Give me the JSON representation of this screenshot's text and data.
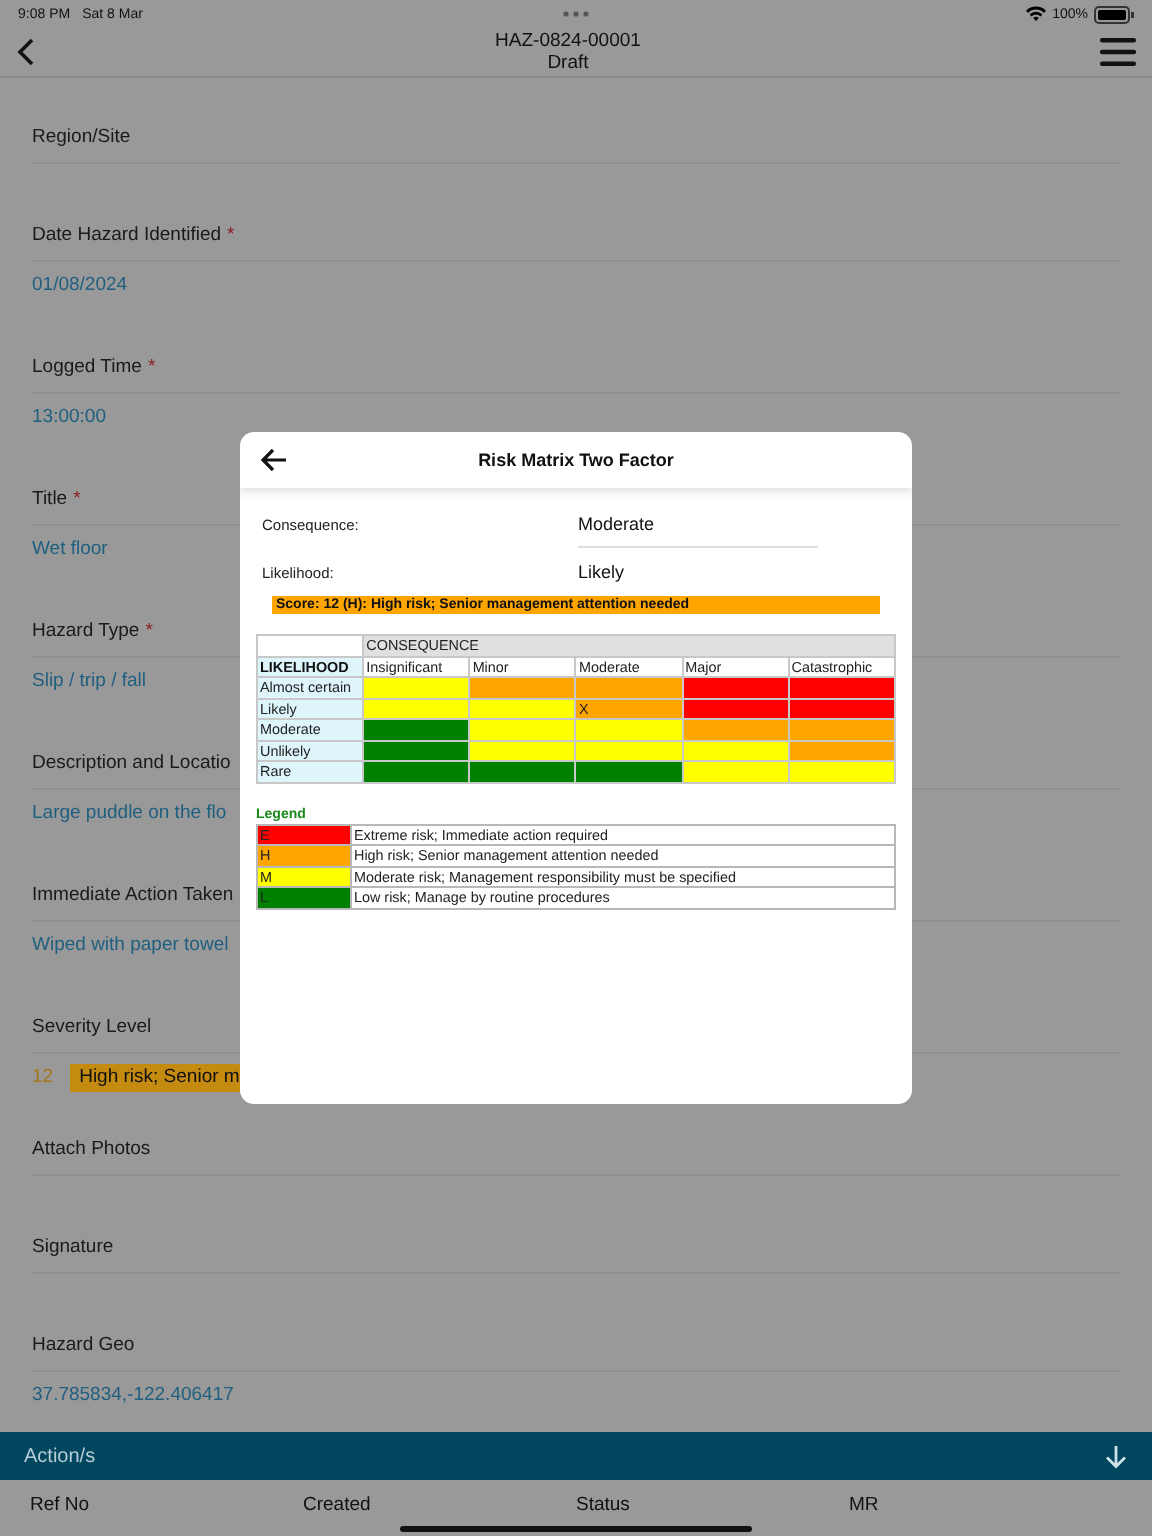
{
  "status_bar": {
    "time": "9:08 PM",
    "date": "Sat 8 Mar",
    "battery": "100%"
  },
  "nav": {
    "title": "HAZ-0824-00001",
    "subtitle": "Draft"
  },
  "fields": [
    {
      "label": "Region/Site"
    },
    {
      "label": "Date Hazard Identified",
      "required_mark": "*",
      "value": "01/08/2024"
    },
    {
      "label": "Logged Time",
      "required_mark": "*",
      "value": "13:00:00"
    },
    {
      "label": "Title",
      "required_mark": "*",
      "value": "Wet floor"
    },
    {
      "label": "Hazard Type",
      "required_mark": "*",
      "value": "Slip / trip / fall"
    },
    {
      "label": "Description and Locatio",
      "value": "Large puddle on the flo"
    },
    {
      "label": "Immediate Action Taken",
      "value": "Wiped with paper towel"
    },
    {
      "label": "Severity Level",
      "kind": "severity",
      "score": "12",
      "badge": "High risk; Senior m",
      "color": "#c58a10"
    },
    {
      "label": "Attach Photos"
    },
    {
      "label": "Signature"
    },
    {
      "label": "Hazard Geo",
      "value": "37.785834,-122.406417"
    }
  ],
  "actions": {
    "title": "Action/s",
    "columns": [
      "Ref No",
      "Created",
      "Status",
      "MR"
    ]
  },
  "modal": {
    "title": "Risk Matrix Two Factor",
    "rows": [
      {
        "label": "Consequence:",
        "value": "Moderate"
      },
      {
        "label": "Likelihood:",
        "value": "Likely"
      }
    ],
    "score": {
      "text": "Score: 12 (H): High risk; Senior management attention needed",
      "color": "#ffa500"
    },
    "matrix": {
      "group_header": "CONSEQUENCE",
      "corner": "LIKELIHOOD",
      "columns": [
        "Insignificant",
        "Minor",
        "Moderate",
        "Major",
        "Catastrophic"
      ],
      "rows": [
        {
          "label": "Almost certain",
          "cells": [
            {
              "color": "#ffff00"
            },
            {
              "color": "#ffa500"
            },
            {
              "color": "#ffa500"
            },
            {
              "color": "#ff0000"
            },
            {
              "color": "#ff0000"
            }
          ]
        },
        {
          "label": "Likely",
          "cells": [
            {
              "color": "#ffff00"
            },
            {
              "color": "#ffff00"
            },
            {
              "color": "#ffa500",
              "text": "X"
            },
            {
              "color": "#ff0000"
            },
            {
              "color": "#ff0000"
            }
          ]
        },
        {
          "label": "Moderate",
          "cells": [
            {
              "color": "#008000"
            },
            {
              "color": "#ffff00"
            },
            {
              "color": "#ffff00"
            },
            {
              "color": "#ffa500"
            },
            {
              "color": "#ffa500"
            }
          ]
        },
        {
          "label": "Unlikely",
          "cells": [
            {
              "color": "#008000"
            },
            {
              "color": "#ffff00"
            },
            {
              "color": "#ffff00"
            },
            {
              "color": "#ffff00"
            },
            {
              "color": "#ffa500"
            }
          ]
        },
        {
          "label": "Rare",
          "cells": [
            {
              "color": "#008000"
            },
            {
              "color": "#008000"
            },
            {
              "color": "#008000"
            },
            {
              "color": "#ffff00"
            },
            {
              "color": "#ffff00"
            }
          ]
        }
      ]
    },
    "legend_title": "Legend",
    "legend": [
      {
        "code": "E",
        "color": "#ff0000",
        "text": "Extreme risk; Immediate action required"
      },
      {
        "code": "H",
        "color": "#ffa500",
        "text": "High risk; Senior management attention needed"
      },
      {
        "code": "M",
        "color": "#ffff00",
        "text": "Moderate risk; Management responsibility must be specified"
      },
      {
        "code": "L",
        "color": "#008000",
        "text": "Low risk; Manage by routine procedures"
      }
    ]
  }
}
